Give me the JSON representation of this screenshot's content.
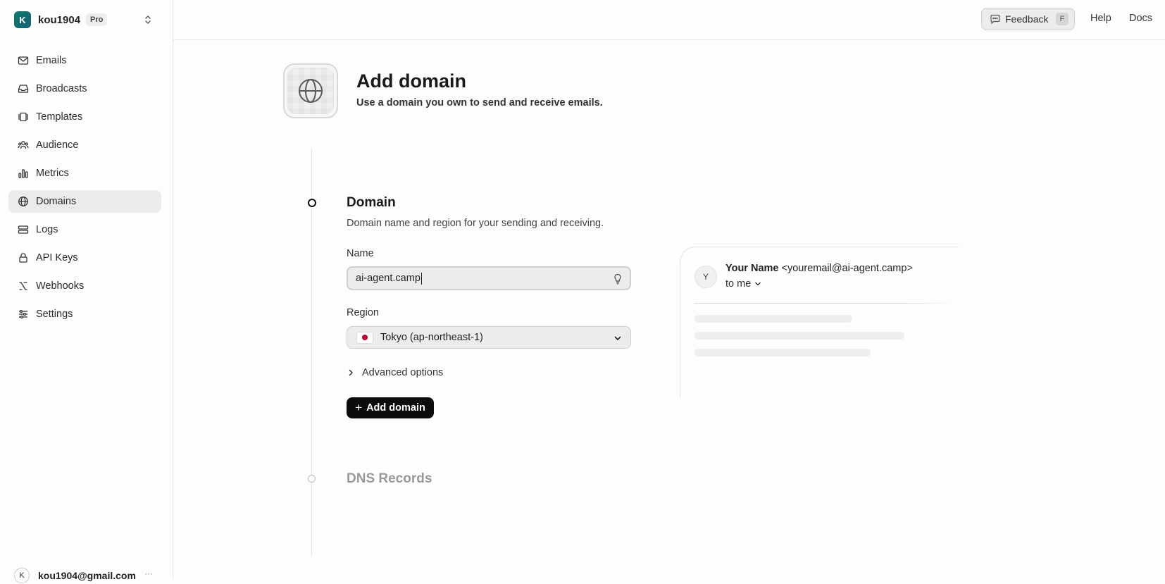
{
  "sidebar": {
    "team": {
      "initial": "K",
      "name": "kou1904",
      "plan": "Pro"
    },
    "nav": [
      {
        "label": "Emails",
        "icon": "mail-icon"
      },
      {
        "label": "Broadcasts",
        "icon": "inbox-icon"
      },
      {
        "label": "Templates",
        "icon": "templates-icon"
      },
      {
        "label": "Audience",
        "icon": "users-icon"
      },
      {
        "label": "Metrics",
        "icon": "bar-chart-icon"
      },
      {
        "label": "Domains",
        "icon": "globe-icon",
        "active": true
      },
      {
        "label": "Logs",
        "icon": "logs-icon"
      },
      {
        "label": "API Keys",
        "icon": "lock-icon"
      },
      {
        "label": "Webhooks",
        "icon": "webhook-icon"
      },
      {
        "label": "Settings",
        "icon": "sliders-icon"
      }
    ],
    "user": {
      "initial": "K",
      "email": "kou1904@gmail.com",
      "more": "···"
    }
  },
  "topbar": {
    "feedback_label": "Feedback",
    "feedback_shortcut": "F",
    "help_label": "Help",
    "docs_label": "Docs"
  },
  "header": {
    "title": "Add domain",
    "subtitle": "Use a domain you own to send and receive emails."
  },
  "domain_section": {
    "title": "Domain",
    "description": "Domain name and region for your sending and receiving.",
    "name_label": "Name",
    "name_value": "ai-agent.camp",
    "region_label": "Region",
    "region_value": "Tokyo (ap-northeast-1)",
    "advanced_label": "Advanced options",
    "submit_label": "Add domain"
  },
  "dns_section": {
    "title": "DNS Records"
  },
  "preview": {
    "avatar_initial": "Y",
    "sender_name": "Your Name",
    "sender_email": "<youremail@ai-agent.camp>",
    "to_label": "to me"
  },
  "colors": {
    "accent": "#0c0c0c",
    "active_nav_bg": "#ebebeb",
    "muted_text": "#9a9a9a",
    "japan_flag_red": "#bc002d"
  }
}
